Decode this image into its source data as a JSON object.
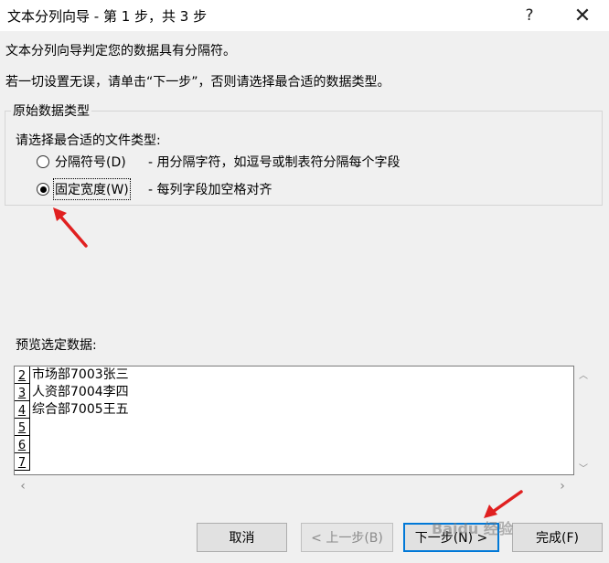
{
  "window": {
    "title": "文本分列向导 - 第 1 步，共 3 步",
    "help_glyph": "?",
    "close_glyph": "✕"
  },
  "intro": {
    "line1": "文本分列向导判定您的数据具有分隔符。",
    "line2": "若一切设置无误，请单击“下一步”，否则请选择最合适的数据类型。"
  },
  "group": {
    "legend": "原始数据类型",
    "prompt": "请选择最合适的文件类型:",
    "options": [
      {
        "label": "分隔符号(D)",
        "description": "- 用分隔字符，如逗号或制表符分隔每个字段",
        "checked": false
      },
      {
        "label": "固定宽度(W)",
        "description": "- 每列字段加空格对齐",
        "checked": true
      }
    ]
  },
  "preview": {
    "label": "预览选定数据:",
    "rows": [
      {
        "num": "2",
        "text": "市场部7003张三"
      },
      {
        "num": "3",
        "text": "人资部7004李四"
      },
      {
        "num": "4",
        "text": "综合部7005王五"
      },
      {
        "num": "5",
        "text": ""
      },
      {
        "num": "6",
        "text": ""
      },
      {
        "num": "7",
        "text": ""
      }
    ]
  },
  "buttons": {
    "cancel": "取消",
    "back": "< 上一步(B)",
    "next": "下一步(N) >",
    "finish": "完成(F)"
  },
  "watermark": "Baidu 经验",
  "colors": {
    "annotation_arrow": "#e02020",
    "default_button_border": "#0078d7"
  }
}
